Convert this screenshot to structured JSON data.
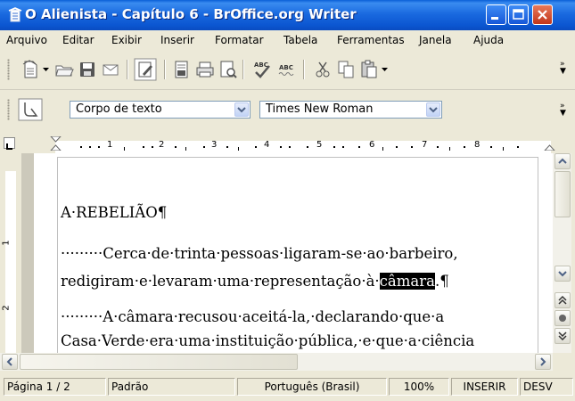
{
  "window": {
    "title": "O Alienista - Capítulo 6 - BrOffice.org Writer"
  },
  "menu": [
    {
      "label": "Arquivo"
    },
    {
      "label": "Editar"
    },
    {
      "label": "Exibir"
    },
    {
      "label": "Inserir"
    },
    {
      "label": "Formatar"
    },
    {
      "label": "Tabela"
    },
    {
      "label": "Ferramentas"
    },
    {
      "label": "Janela"
    },
    {
      "label": "Ajuda"
    }
  ],
  "format_bar": {
    "paragraph_style": "Corpo de texto",
    "font_name": "Times New Roman"
  },
  "ruler": {
    "numbers": [
      "1",
      "2",
      "3",
      "4",
      "5",
      "6",
      "7",
      "8"
    ]
  },
  "document": {
    "heading": "A·REBELIÃO¶",
    "p1_line1": "·········Cerca·de·trinta·pessoas·ligaram-se·ao·barbeiro,",
    "p1_line2_before": "redigiram·e·levaram·uma·representação·à·",
    "p1_selected": "câmara",
    "p1_line2_after": ".¶",
    "p2_line1": "·········A·câmara·recusou·aceitá-la,·declarando·que·a",
    "p2_line2": "Casa·Verde·era·uma·instituição·pública,·e·que·a·ciência"
  },
  "statusbar": {
    "page": "Página 1 / 2",
    "style": "Padrão",
    "language": "Português (Brasil)",
    "zoom": "100%",
    "insert_mode": "INSERIR",
    "selection_mode": "DESV"
  },
  "colors": {
    "titlebar": "#0b55d0",
    "chrome": "#ece9d8",
    "selection": "#000000"
  }
}
